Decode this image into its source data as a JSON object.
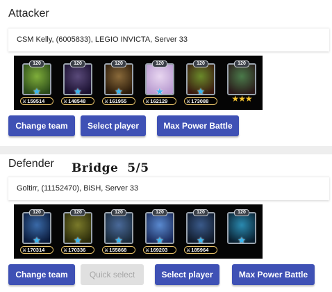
{
  "attacker": {
    "title": "Attacker",
    "player": "CSM Kelly, (6005833), LEGIO INVICTA, Server 33",
    "heroes": [
      {
        "level": "120",
        "power": "159514",
        "colors": [
          "#7fae3a",
          "#2b4a1a"
        ],
        "rank": "star-icon"
      },
      {
        "level": "120",
        "power": "148548",
        "colors": [
          "#5a4a7a",
          "#1a1030"
        ],
        "rank": "star-icon"
      },
      {
        "level": "120",
        "power": "161955",
        "colors": [
          "#8a6a3a",
          "#2a1a0a"
        ],
        "rank": "star-icon"
      },
      {
        "level": "120",
        "power": "162129",
        "colors": [
          "#e8d6f0",
          "#b89ad0"
        ],
        "rank": "star-icon"
      },
      {
        "level": "120",
        "power": "173088",
        "colors": [
          "#6a8a2a",
          "#3a1a10"
        ],
        "rank": "star-icon"
      },
      {
        "level": "120",
        "power": "",
        "colors": [
          "#4a7a4a",
          "#2a1a1a"
        ],
        "rank": "stars",
        "stars": "★★★"
      }
    ],
    "buttons": {
      "change_team": "Change team",
      "select_player": "Select player",
      "max_power": "Max Power Battle"
    }
  },
  "defender": {
    "title": "Defender",
    "overlay": "Bridge  5/5",
    "player": "Goltirr, (11152470), BiSH, Server 33",
    "heroes": [
      {
        "level": "120",
        "power": "170314",
        "colors": [
          "#3a6aa8",
          "#0a1a3a"
        ],
        "rank": "star-icon"
      },
      {
        "level": "120",
        "power": "170336",
        "colors": [
          "#7a7a2a",
          "#2a2a0a"
        ],
        "rank": "star-icon"
      },
      {
        "level": "120",
        "power": "155868",
        "colors": [
          "#4a6a9a",
          "#1a2a3a"
        ],
        "rank": "star-icon"
      },
      {
        "level": "120",
        "power": "169203",
        "colors": [
          "#5a8ad0",
          "#1a2a5a"
        ],
        "rank": "star-icon"
      },
      {
        "level": "120",
        "power": "185964",
        "colors": [
          "#3a5a8a",
          "#101a2a"
        ],
        "rank": "star-icon"
      },
      {
        "level": "120",
        "power": "",
        "colors": [
          "#2a8ab0",
          "#0a2030"
        ],
        "rank": "star-icon"
      }
    ],
    "buttons": {
      "change_team": "Change team",
      "quick_select": "Quick select",
      "select_player": "Select player",
      "max_power": "Max Power Battle"
    }
  },
  "colors": {
    "primary": "#3f51b5",
    "disabled": "#e0e0e0",
    "power_border": "#e8c36a",
    "rank_star": "#38b6f0"
  }
}
